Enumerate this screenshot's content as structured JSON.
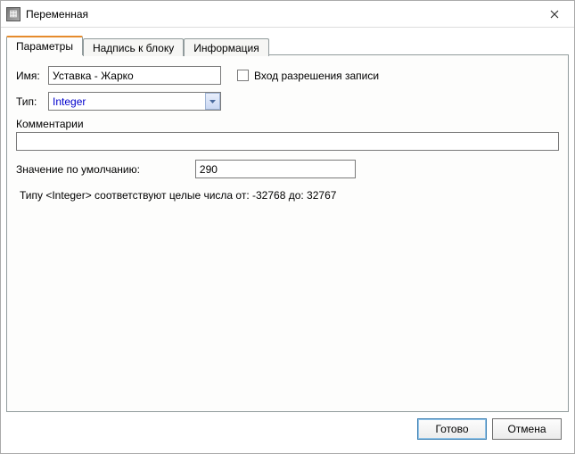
{
  "window": {
    "title": "Переменная"
  },
  "tabs": {
    "params": "Параметры",
    "label_block": "Надпись к блоку",
    "info": "Информация"
  },
  "form": {
    "name_label": "Имя:",
    "name_value": "Уставка - Жарко",
    "type_label": "Тип:",
    "type_value": "Integer",
    "write_enable_label": "Вход разрешения записи",
    "comment_label": "Комментарии",
    "comment_value": "",
    "default_label": "Значение по умолчанию:",
    "default_value": "290",
    "hint": "Типу <Integer> соответствуют целые числа от: -32768 до: 32767"
  },
  "buttons": {
    "ok": "Готово",
    "cancel": "Отмена"
  }
}
